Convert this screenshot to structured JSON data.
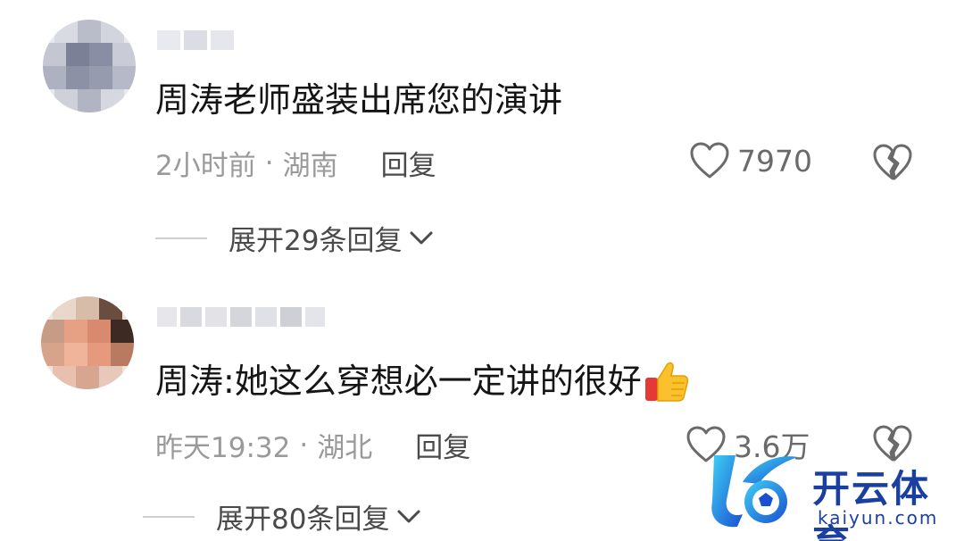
{
  "comments": [
    {
      "username": "",
      "text": "周涛老师盛装出席您的演讲",
      "time": "2小时前",
      "separator": "·",
      "location": "湖南",
      "reply_label": "回复",
      "likes": "7970",
      "expand_label": "展开29条回复"
    },
    {
      "username": "",
      "text": "周涛:她这么穿想必一定讲的很好",
      "emoji": "thumbs-up-icon",
      "time": "昨天19:32",
      "separator": "·",
      "location": "湖北",
      "reply_label": "回复",
      "likes": "3.6万",
      "expand_label": "展开80条回复"
    }
  ],
  "watermark": {
    "title": "开云体育",
    "url": "kaiyun.com"
  },
  "colors": {
    "text_primary": "#151515",
    "text_secondary": "#9a9a9a",
    "watermark": "#1a3fa0"
  }
}
